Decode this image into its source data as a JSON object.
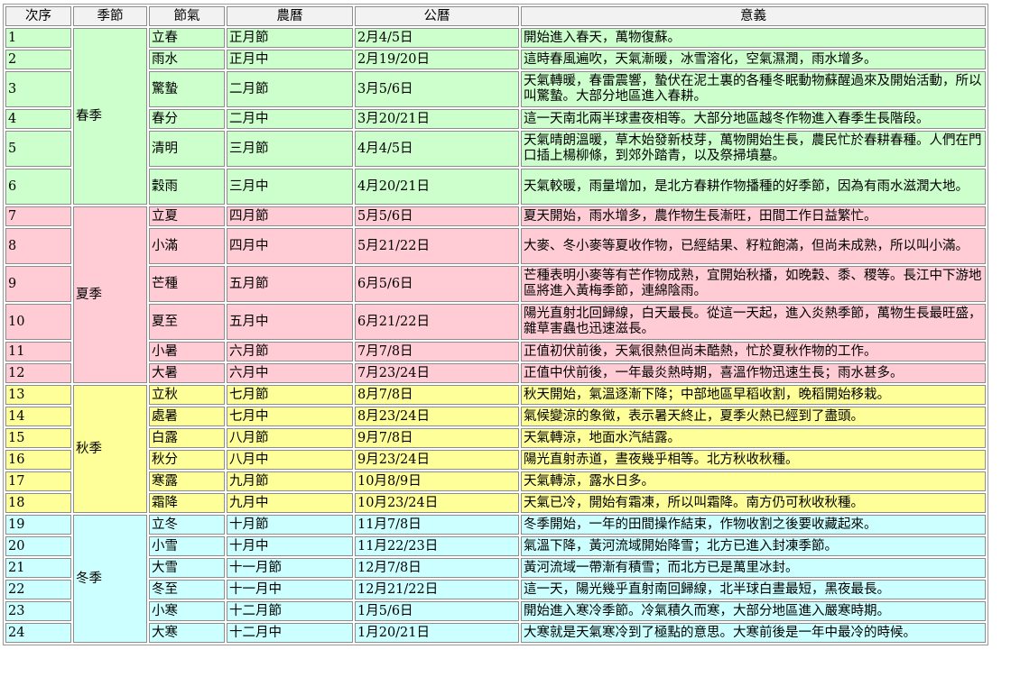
{
  "headers": [
    "次序",
    "季節",
    "節氣",
    "農曆",
    "公曆",
    "意義"
  ],
  "colors": {
    "春季": "#ccffcc",
    "夏季": "#ffccd5",
    "秋季": "#ffff99",
    "冬季": "#ccffff"
  },
  "seasons": [
    {
      "name": "春季",
      "span": 6
    },
    {
      "name": "夏季",
      "span": 6
    },
    {
      "name": "秋季",
      "span": 6
    },
    {
      "name": "冬季",
      "span": 6
    }
  ],
  "rows": [
    {
      "no": "1",
      "season": "春季",
      "term": "立春",
      "lunar": "正月節",
      "solar": "2月4/5日",
      "meaning": "開始進入春天，萬物復蘇。",
      "lines": 1
    },
    {
      "no": "2",
      "season": "春季",
      "term": "雨水",
      "lunar": "正月中",
      "solar": "2月19/20日",
      "meaning": "這時春風遍吹，天氣漸暖，冰雪溶化，空氣濕潤，雨水增多。",
      "lines": 1
    },
    {
      "no": "3",
      "season": "春季",
      "term": "驚蟄",
      "lunar": "二月節",
      "solar": "3月5/6日",
      "meaning": "天氣轉暖，春雷震響，蟄伏在泥土裏的各種冬眠動物蘇醒過來及開始活動，所以叫驚蟄。大部分地區進入春耕。",
      "lines": 2
    },
    {
      "no": "4",
      "season": "春季",
      "term": "春分",
      "lunar": "二月中",
      "solar": "3月20/21日",
      "meaning": "這一天南北兩半球晝夜相等。大部分地區越冬作物進入春季生長階段。",
      "lines": 1
    },
    {
      "no": "5",
      "season": "春季",
      "term": "清明",
      "lunar": "三月節",
      "solar": "4月4/5日",
      "meaning": "天氣晴朗溫暖，草木始發新枝芽，萬物開始生長，農民忙於春耕春種。人們在門口插上楊柳條，到郊外踏青，以及祭掃墳墓。",
      "lines": 2
    },
    {
      "no": "6",
      "season": "春季",
      "term": "穀雨",
      "lunar": "三月中",
      "solar": "4月20/21日",
      "meaning": "天氣較暖，雨量增加，是北方春耕作物播種的好季節，因為有雨水滋潤大地。",
      "lines": 2
    },
    {
      "no": "7",
      "season": "夏季",
      "term": "立夏",
      "lunar": "四月節",
      "solar": "5月5/6日",
      "meaning": "夏天開始，雨水增多，農作物生長漸旺，田間工作日益繁忙。",
      "lines": 1
    },
    {
      "no": "8",
      "season": "夏季",
      "term": "小滿",
      "lunar": "四月中",
      "solar": "5月21/22日",
      "meaning": "大麥、冬小麥等夏收作物，已經結果、籽粒飽滿，但尚未成熟，所以叫小滿。",
      "lines": 2
    },
    {
      "no": "9",
      "season": "夏季",
      "term": "芒種",
      "lunar": "五月節",
      "solar": "6月5/6日",
      "meaning": "芒種表明小麥等有芒作物成熟，宜開始秋播，如晚穀、黍、稷等。長江中下游地區將進入黃梅季節，連綿陰雨。",
      "lines": 2
    },
    {
      "no": "10",
      "season": "夏季",
      "term": "夏至",
      "lunar": "五月中",
      "solar": "6月21/22日",
      "meaning": "陽光直射北回歸線，白天最長。從這一天起，進入炎熱季節，萬物生長最旺盛，雜草害蟲也迅速滋長。",
      "lines": 2
    },
    {
      "no": "11",
      "season": "夏季",
      "term": "小暑",
      "lunar": "六月節",
      "solar": "7月7/8日",
      "meaning": "正值初伏前後，天氣很熱但尚未酷熱，忙於夏秋作物的工作。",
      "lines": 1
    },
    {
      "no": "12",
      "season": "夏季",
      "term": "大暑",
      "lunar": "六月中",
      "solar": "7月23/24日",
      "meaning": "正值中伏前後，一年最炎熱時期，喜溫作物迅速生長；雨水甚多。",
      "lines": 1
    },
    {
      "no": "13",
      "season": "秋季",
      "term": "立秋",
      "lunar": "七月節",
      "solar": "8月7/8日",
      "meaning": "秋天開始，氣溫逐漸下降；中部地區早稻收割，晚稻開始移栽。",
      "lines": 1
    },
    {
      "no": "14",
      "season": "秋季",
      "term": "處暑",
      "lunar": "七月中",
      "solar": "8月23/24日",
      "meaning": "氣候變涼的象徵，表示暑天終止，夏季火熱已經到了盡頭。",
      "lines": 1
    },
    {
      "no": "15",
      "season": "秋季",
      "term": "白露",
      "lunar": "八月節",
      "solar": "9月7/8日",
      "meaning": "天氣轉涼，地面水汽結露。",
      "lines": 1
    },
    {
      "no": "16",
      "season": "秋季",
      "term": "秋分",
      "lunar": "八月中",
      "solar": "9月23/24日",
      "meaning": "陽光直射赤道，晝夜幾乎相等。北方秋收秋種。",
      "lines": 1
    },
    {
      "no": "17",
      "season": "秋季",
      "term": "寒露",
      "lunar": "九月節",
      "solar": "10月8/9日",
      "meaning": "天氣轉涼，露水日多。",
      "lines": 1
    },
    {
      "no": "18",
      "season": "秋季",
      "term": "霜降",
      "lunar": "九月中",
      "solar": "10月23/24日",
      "meaning": "天氣已冷，開始有霜凍，所以叫霜降。南方仍可秋收秋種。",
      "lines": 1
    },
    {
      "no": "19",
      "season": "冬季",
      "term": "立冬",
      "lunar": "十月節",
      "solar": "11月7/8日",
      "meaning": "冬季開始，一年的田間操作結束，作物收割之後要收藏起來。",
      "lines": 1
    },
    {
      "no": "20",
      "season": "冬季",
      "term": "小雪",
      "lunar": "十月中",
      "solar": "11月22/23日",
      "meaning": "氣溫下降，黃河流域開始降雪；北方已進入封凍季節。",
      "lines": 1
    },
    {
      "no": "21",
      "season": "冬季",
      "term": "大雪",
      "lunar": "十一月節",
      "solar": "12月7/8日",
      "meaning": "黃河流域一帶漸有積雪；而北方已是萬里冰封。",
      "lines": 1
    },
    {
      "no": "22",
      "season": "冬季",
      "term": "冬至",
      "lunar": "十一月中",
      "solar": "12月21/22日",
      "meaning": "這一天，陽光幾乎直射南回歸線，北半球白晝最短，黑夜最長。",
      "lines": 1
    },
    {
      "no": "23",
      "season": "冬季",
      "term": "小寒",
      "lunar": "十二月節",
      "solar": "1月5/6日",
      "meaning": "開始進入寒冷季節。冷氣積久而寒，大部分地區進入嚴寒時期。",
      "lines": 1
    },
    {
      "no": "24",
      "season": "冬季",
      "term": "大寒",
      "lunar": "十二月中",
      "solar": "1月20/21日",
      "meaning": "大寒就是天氣寒冷到了極點的意思。大寒前後是一年中最冷的時候。",
      "lines": 1
    }
  ]
}
